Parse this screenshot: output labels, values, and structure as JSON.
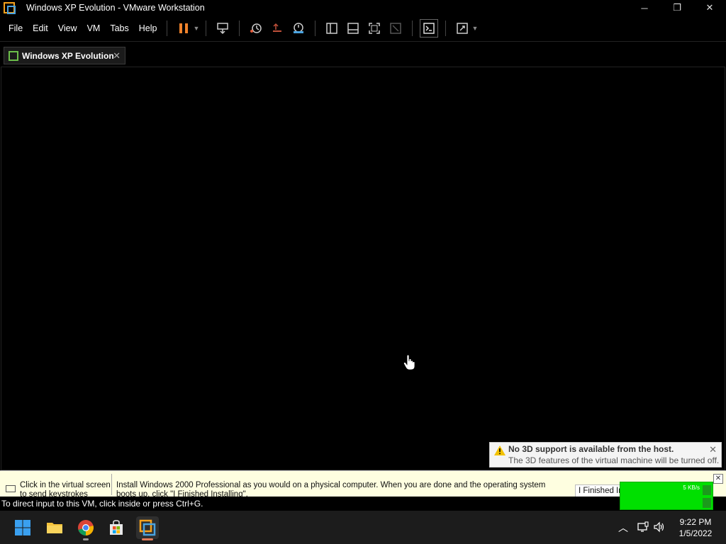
{
  "window": {
    "title": "Windows XP Evolution - VMware Workstation",
    "controls": {
      "minimize": "─",
      "restore": "❐",
      "close": "✕"
    }
  },
  "menu": [
    "File",
    "Edit",
    "View",
    "VM",
    "Tabs",
    "Help"
  ],
  "toolbar": {
    "icons": [
      "pause-icon",
      "send-ctrl-alt-del-icon",
      "snapshot-icon",
      "revert-snapshot-icon",
      "snapshot-manager-icon",
      "library-view-icon",
      "thumbnail-bar-icon",
      "fullscreen-icon",
      "unity-icon",
      "console-view-icon",
      "stretch-icon"
    ],
    "accent": "#f0822b"
  },
  "tab": {
    "label": "Windows XP Evolution",
    "close": "✕"
  },
  "notice": {
    "title": "No 3D support is available from the host.",
    "text": "The 3D features of the virtual machine will be turned off.",
    "close": "✕"
  },
  "hint": {
    "left": "Click in the virtual screen to send keystrokes",
    "main": "Install Windows 2000 Professional as you would on a physical computer. When you are done and the operating system boots up, click \"I Finished Installing\".",
    "button": "I Finished Installing",
    "close": "✕",
    "background": "#fefee0"
  },
  "net_widget": {
    "speed": "5 KB/s",
    "color": "#00e000"
  },
  "status": {
    "text": "To direct input to this VM, click inside or press Ctrl+G."
  },
  "taskbar": {
    "apps": [
      "windows-start-icon",
      "file-explorer-icon",
      "chrome-icon",
      "microsoft-store-icon",
      "vmware-workstation-icon"
    ],
    "tray": {
      "chevron": "︿",
      "time": "9:22 PM",
      "date": "1/5/2022"
    }
  }
}
